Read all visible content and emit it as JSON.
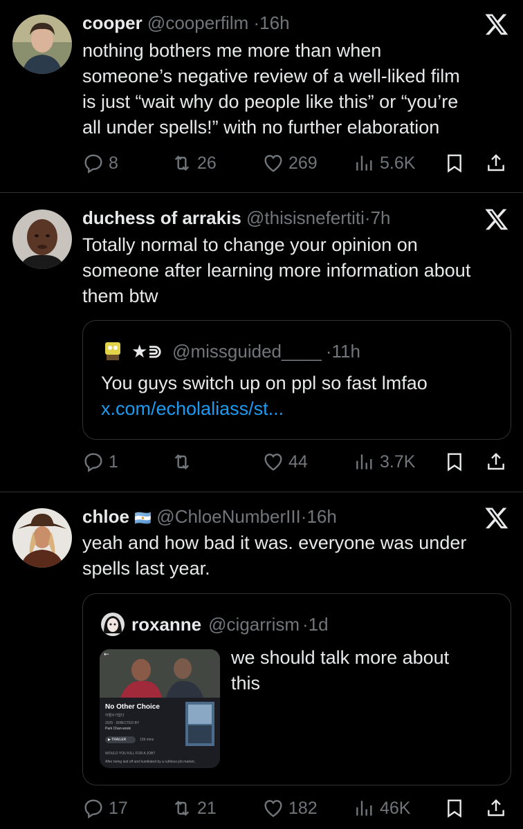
{
  "tweets": [
    {
      "name": "cooper",
      "handle": "@cooperfilm",
      "time": "16h",
      "text_lines": [
        "nothing bothers me more than when",
        "someone’s negative review of a well-liked film",
        "is just “wait why do people like this” or “you’re",
        "all under spells!” with no further elaboration"
      ],
      "replies": "8",
      "reposts": "26",
      "likes": "269",
      "views": "5.6K"
    },
    {
      "name": "duchess of arrakis",
      "handle": "@thisisnefertiti",
      "time": "7h",
      "text_lines": [
        "Totally normal to change your opinion on",
        "someone after learning more information about",
        "them btw"
      ],
      "quote": {
        "name": "★⋑",
        "handle": "@missguided____",
        "time": "11h",
        "text": "You guys switch up on ppl so fast lmfao",
        "link": "x.com/echolaliass/st..."
      },
      "replies": "1",
      "reposts": "",
      "likes": "44",
      "views": "3.7K"
    },
    {
      "name": "chloe",
      "flag": "🇦🇷",
      "handle": "@ChloeNumberIII",
      "time": "16h",
      "text_lines": [
        "yeah and how bad it was. everyone was under",
        "spells last year."
      ],
      "quote": {
        "name": "roxanne",
        "handle": "@cigarrism",
        "time": "1d",
        "text_lines": [
          "we should talk more about",
          "this"
        ],
        "media": {
          "title": "No Other Choice",
          "korean": "어쩔수가없다",
          "meta": "2025 · DIRECTED BY",
          "director": "Park Chan-wook",
          "trailer": "▶ TRAILER",
          "runtime": "139 mins",
          "prompt": "WOULD YOU KILL FOR A JOB?",
          "desc": "After being laid off and humiliated by a ruthless job market,"
        }
      },
      "replies": "17",
      "reposts": "21",
      "likes": "182",
      "views": "46K"
    }
  ],
  "icons": {
    "reply": "reply-icon",
    "repost": "repost-icon",
    "like": "heart-icon",
    "views": "views-icon",
    "bookmark": "bookmark-icon",
    "share": "share-icon",
    "logo": "x-logo-icon"
  },
  "colors": {
    "background": "#000000",
    "text": "#e7e9ea",
    "muted": "#71767b",
    "link": "#1d9bf0",
    "border": "#2f3336"
  }
}
